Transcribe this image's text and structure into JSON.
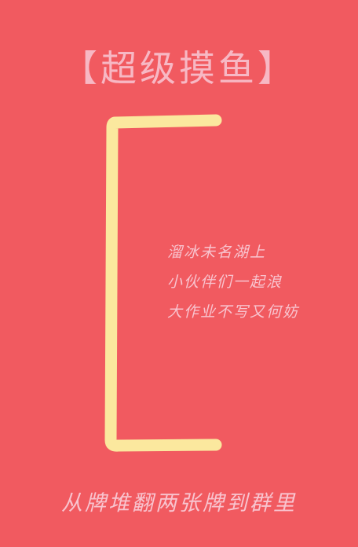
{
  "title": "【超级摸鱼】",
  "poem": {
    "lines": [
      "溜冰未名湖上",
      "小伙伴们一起浪",
      "大作业不写又何妨"
    ]
  },
  "footer": "从牌堆翻两张牌到群里",
  "colors": {
    "background": "#f15a60",
    "title": "#f7b8c4",
    "text": "#f8c4cf",
    "bracket": "#fbe89e"
  }
}
